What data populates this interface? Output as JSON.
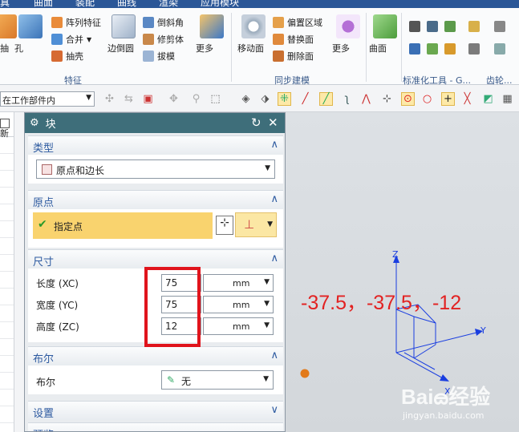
{
  "menubar": {
    "items": [
      "真",
      "曲面",
      "装配",
      "曲线",
      "渲染",
      "应用模块"
    ]
  },
  "ribbon": {
    "feature_group": {
      "label": "特征",
      "big_buttons": [
        "抽",
        "孔",
        "边倒圆",
        "更多"
      ],
      "small_buttons": [
        "阵列特征",
        "合并",
        "抽壳",
        "倒斜角",
        "修剪体",
        "拔模"
      ]
    },
    "sync_group": {
      "label": "同步建模",
      "big_buttons": [
        "移动面",
        "更多"
      ],
      "small_buttons": [
        "偏置区域",
        "替换面",
        "删除面"
      ]
    },
    "surface_group": {
      "big_buttons": [
        "曲面"
      ]
    },
    "standard_group": {
      "label": "标准化工具 - G..."
    },
    "gear_group": {
      "label": "齿轮..."
    }
  },
  "selection_bar": {
    "filter_value": "在工作部件内"
  },
  "left_strip": {
    "header": "新"
  },
  "dialog": {
    "title": "块",
    "sections": {
      "type": {
        "header": "类型",
        "value": "原点和边长"
      },
      "origin": {
        "header": "原点",
        "specify_point": "指定点"
      },
      "dimensions": {
        "header": "尺寸",
        "rows": [
          {
            "label": "长度 (XC)",
            "value": "75",
            "unit": "mm"
          },
          {
            "label": "宽度 (YC)",
            "value": "75",
            "unit": "mm"
          },
          {
            "label": "高度 (ZC)",
            "value": "12",
            "unit": "mm"
          }
        ]
      },
      "boolean": {
        "header": "布尔",
        "label": "布尔",
        "value": "无"
      },
      "settings": {
        "header": "设置"
      },
      "preview": {
        "header": "预览"
      }
    }
  },
  "viewport": {
    "coords_text": "-37.5，-37.5，-12",
    "axis_z": "Z",
    "axis_y": "Y",
    "axis_x": "X"
  },
  "watermark": {
    "main": "Baiౚ经验",
    "sub": "jingyan.baidu.com"
  },
  "colors": {
    "dialog_title_bg": "#3e6e7a",
    "section_header_text": "#2d5aa0",
    "annotation_red": "#e22222",
    "highlight_yellow": "#f9d36e",
    "axis_blue": "#1a3ee0"
  }
}
